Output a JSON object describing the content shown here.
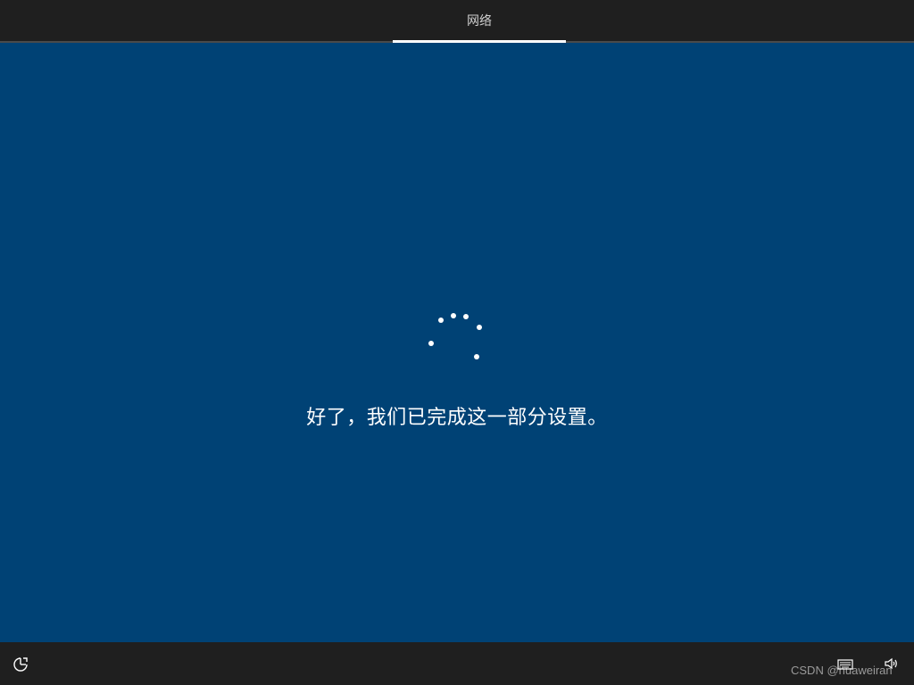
{
  "header": {
    "tab_label": "网络"
  },
  "main": {
    "status_message": "好了，我们已完成这一部分设置。",
    "spinner": {
      "dots": 6
    }
  },
  "footer": {
    "watermark": "CSDN @huaweiran",
    "icons": [
      "ease-of-access-icon",
      "keyboard-icon",
      "volume-icon"
    ]
  },
  "colors": {
    "background": "#004275",
    "bars": "#1f1f1f",
    "text": "#ffffff"
  }
}
